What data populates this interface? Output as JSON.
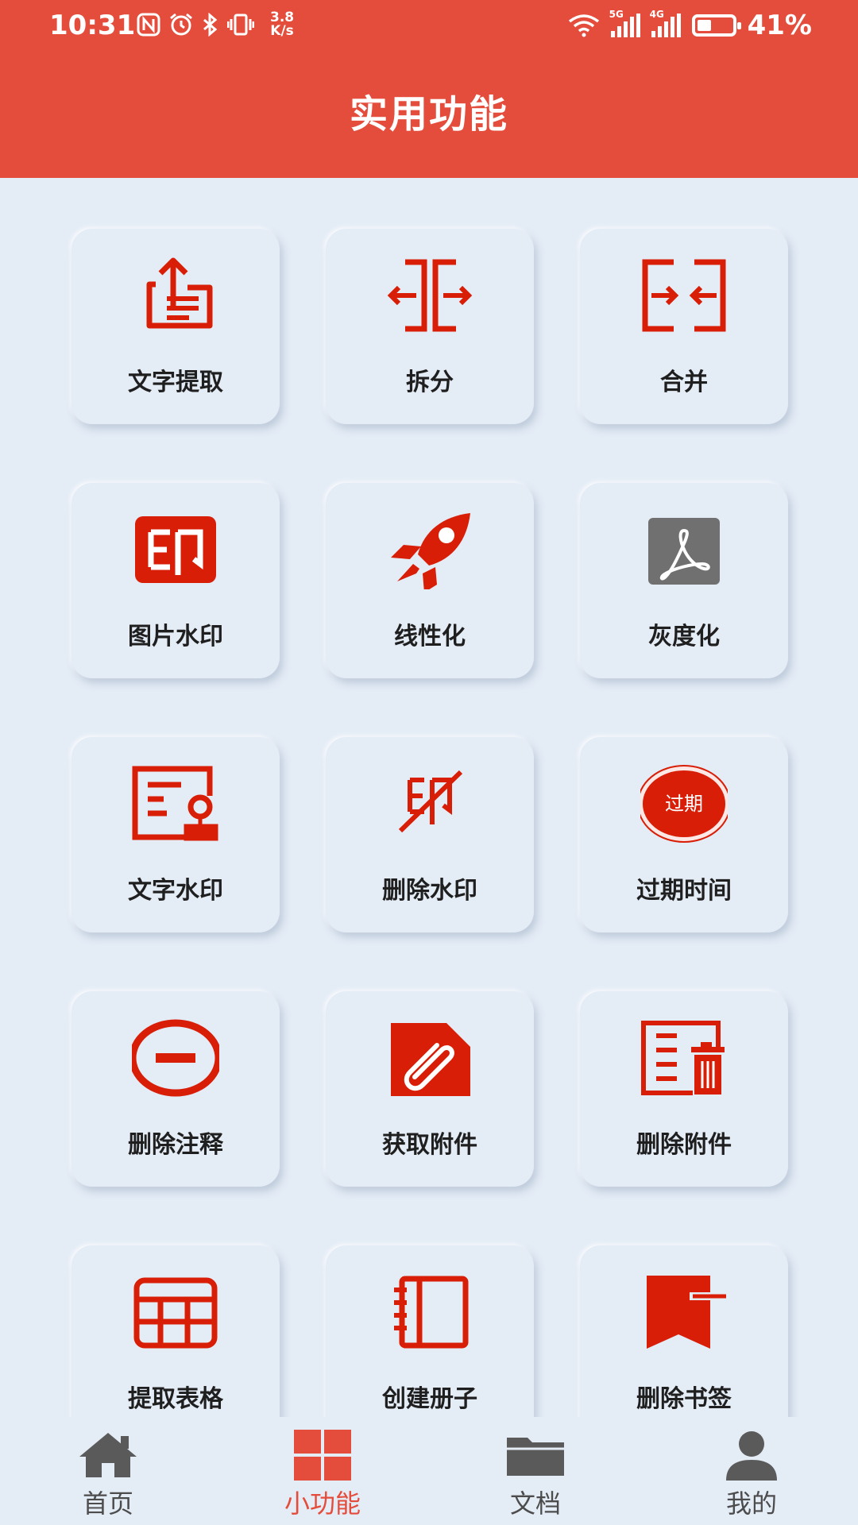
{
  "status_bar": {
    "time": "10:31",
    "net_speed_value": "3.8",
    "net_speed_unit": "K/s",
    "sim1_label": "5G",
    "sim2_label": "4G",
    "battery_level": 0.41,
    "battery_percent": "41%"
  },
  "header": {
    "title": "实用功能"
  },
  "colors": {
    "accent": "#e44c3c",
    "icon_red": "#d81e06",
    "icon_gray": "#707070",
    "background": "#e4ecf6"
  },
  "tools": [
    {
      "label": "文字提取",
      "icon": "text-extract-icon"
    },
    {
      "label": "拆分",
      "icon": "split-icon"
    },
    {
      "label": "合并",
      "icon": "merge-icon"
    },
    {
      "label": "图片水印",
      "icon": "image-watermark-icon"
    },
    {
      "label": "线性化",
      "icon": "rocket-icon"
    },
    {
      "label": "灰度化",
      "icon": "grayscale-pdf-icon"
    },
    {
      "label": "文字水印",
      "icon": "text-watermark-icon"
    },
    {
      "label": "删除水印",
      "icon": "remove-watermark-icon"
    },
    {
      "label": "过期时间",
      "icon": "expiry-icon",
      "icon_text": "过期"
    },
    {
      "label": "删除注释",
      "icon": "remove-annotation-icon"
    },
    {
      "label": "获取附件",
      "icon": "attachment-icon"
    },
    {
      "label": "删除附件",
      "icon": "delete-attachment-icon"
    },
    {
      "label": "提取表格",
      "icon": "table-icon"
    },
    {
      "label": "创建册子",
      "icon": "booklet-icon"
    },
    {
      "label": "删除书签",
      "icon": "remove-bookmark-icon"
    }
  ],
  "tabs": [
    {
      "label": "首页",
      "icon": "home-icon",
      "active": false
    },
    {
      "label": "小功能",
      "icon": "grid-icon",
      "active": true
    },
    {
      "label": "文档",
      "icon": "folder-icon",
      "active": false
    },
    {
      "label": "我的",
      "icon": "user-icon",
      "active": false
    }
  ]
}
